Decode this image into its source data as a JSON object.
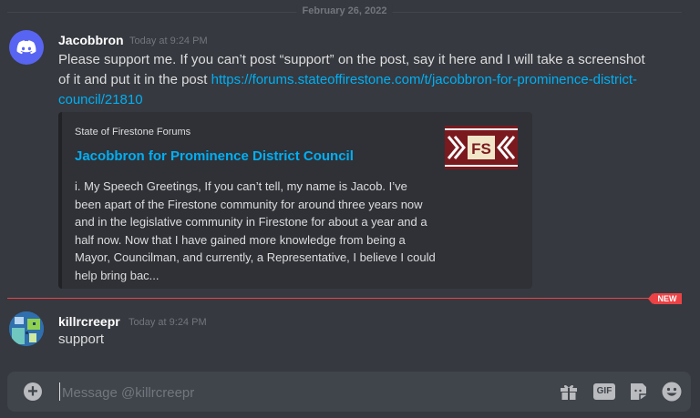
{
  "date_divider": "February 26, 2022",
  "messages": [
    {
      "author": "Jacobbron",
      "timestamp": "Today at 9:24 PM",
      "text": "Please support me. If you can’t post “support” on the post, say it here and I will take a screenshot of it and put it in the post ",
      "link": "https://forums.stateoffirestone.com/t/jacobbron-for-prominence-district-council/21810",
      "embed": {
        "provider": "State of Firestone Forums",
        "title": "Jacobbron for Prominence District Council",
        "description": "i. My Speech Greetings, If you can’t tell, my name is Jacob. I’ve been apart of the Firestone community for around three years now and in the legislative community in Firestone for about a year and a half now. Now that I have gained more knowledge from being a Mayor, Councilman, and currently, a Representative, I believe I could help bring bac...",
        "thumbnail_text": "FS"
      }
    },
    {
      "author": "killrcreepr",
      "timestamp": "Today at 9:24 PM",
      "text": "support"
    }
  ],
  "new_badge": "NEW",
  "composer": {
    "placeholder": "Message @killrcreepr",
    "gif_label": "GIF"
  },
  "colors": {
    "background": "#36393f",
    "link": "#00aff4",
    "new_divider": "#ed4245",
    "discord_blurple": "#5865f2",
    "thumbnail_red": "#7a1a1f"
  },
  "icons": [
    "discord-logo-icon",
    "add-attachment-icon",
    "gift-icon",
    "gif-icon",
    "sticker-icon",
    "emoji-icon"
  ]
}
